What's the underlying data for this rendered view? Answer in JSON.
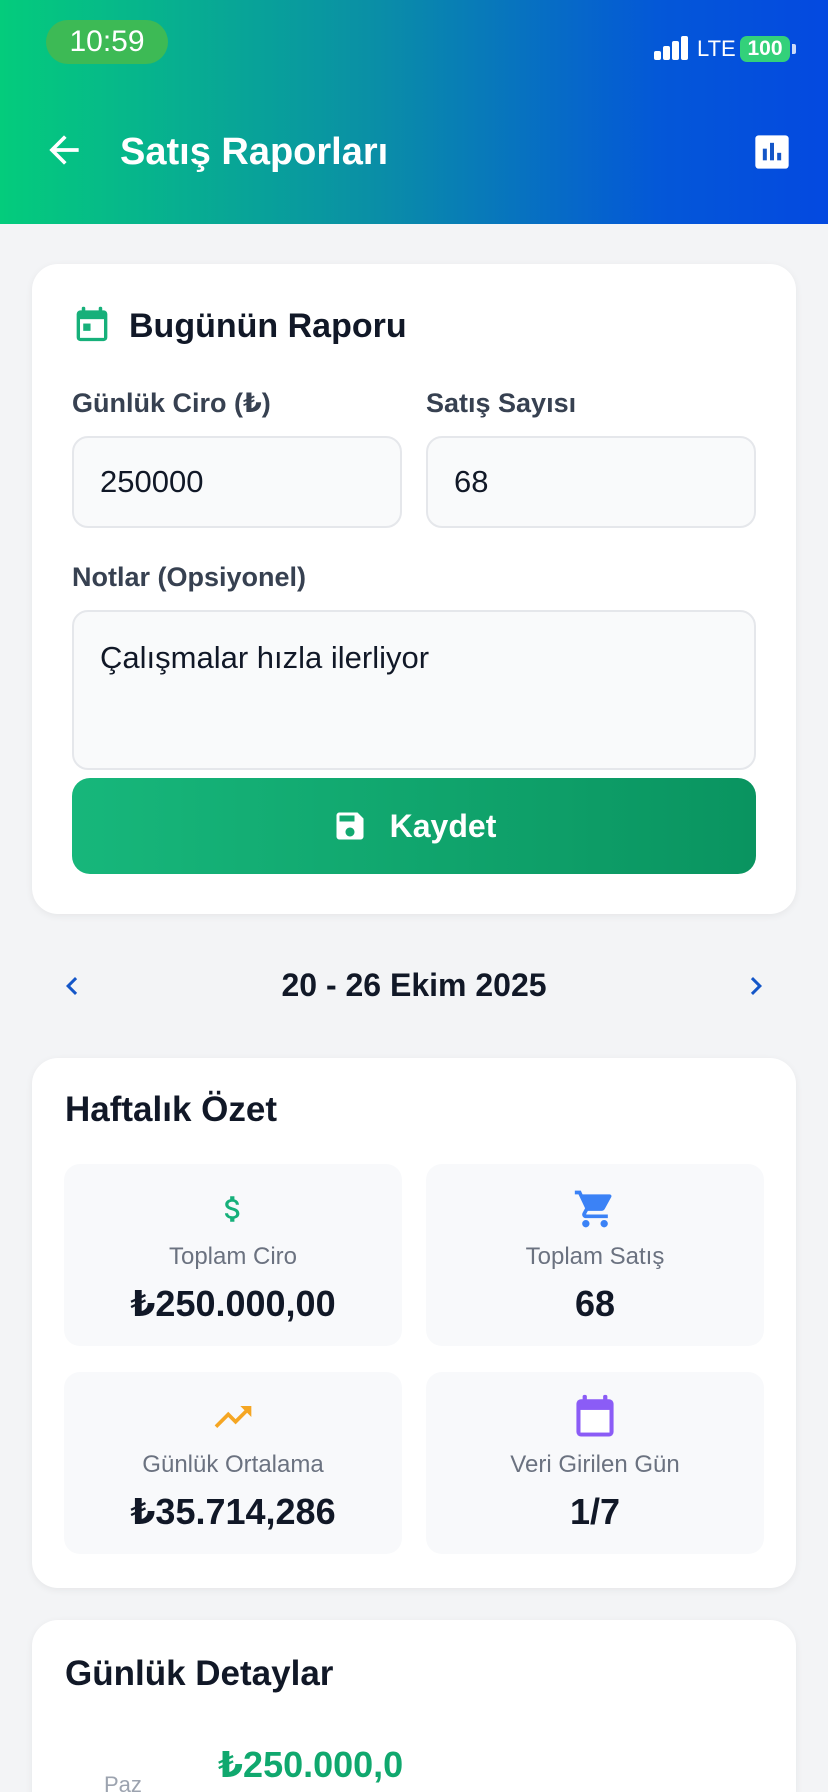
{
  "status_bar": {
    "time": "10:59",
    "network": "LTE",
    "battery": "100"
  },
  "header": {
    "title": "Satış Raporları",
    "back_icon": "arrow-left-icon",
    "report_icon": "bar-chart-icon"
  },
  "today_report": {
    "title": "Bugünün Raporu",
    "icon": "calendar-today-icon",
    "revenue_label": "Günlük Ciro (₺)",
    "revenue_value": "250000",
    "sales_label": "Satış Sayısı",
    "sales_value": "68",
    "notes_label": "Notlar (Opsiyonel)",
    "notes_value": "Çalışmalar hızla ilerliyor",
    "save_label": "Kaydet",
    "save_icon": "save-icon"
  },
  "week_nav": {
    "label": "20 - 26 Ekim 2025",
    "prev_icon": "chevron-left-icon",
    "next_icon": "chevron-right-icon"
  },
  "weekly_summary": {
    "title": "Haftalık Özet",
    "stats": [
      {
        "label": "Toplam Ciro",
        "value": "₺250.000,00",
        "icon": "dollar-icon",
        "color": "#16b07a"
      },
      {
        "label": "Toplam Satış",
        "value": "68",
        "icon": "cart-icon",
        "color": "#3b82f6"
      },
      {
        "label": "Günlük Ortalama",
        "value": "₺35.714,286",
        "icon": "trending-up-icon",
        "color": "#f5a623"
      },
      {
        "label": "Veri Girilen Gün",
        "value": "1/7",
        "icon": "calendar-icon",
        "color": "#8b5cf6"
      }
    ]
  },
  "daily_details": {
    "title": "Günlük Detaylar",
    "rows": [
      {
        "day": "Paz",
        "amount": "₺250.000,0"
      }
    ]
  },
  "colors": {
    "accent_green": "#10a86e",
    "header_start": "#04cc7c",
    "header_end": "#0449e0",
    "nav_blue": "#1456c8"
  }
}
